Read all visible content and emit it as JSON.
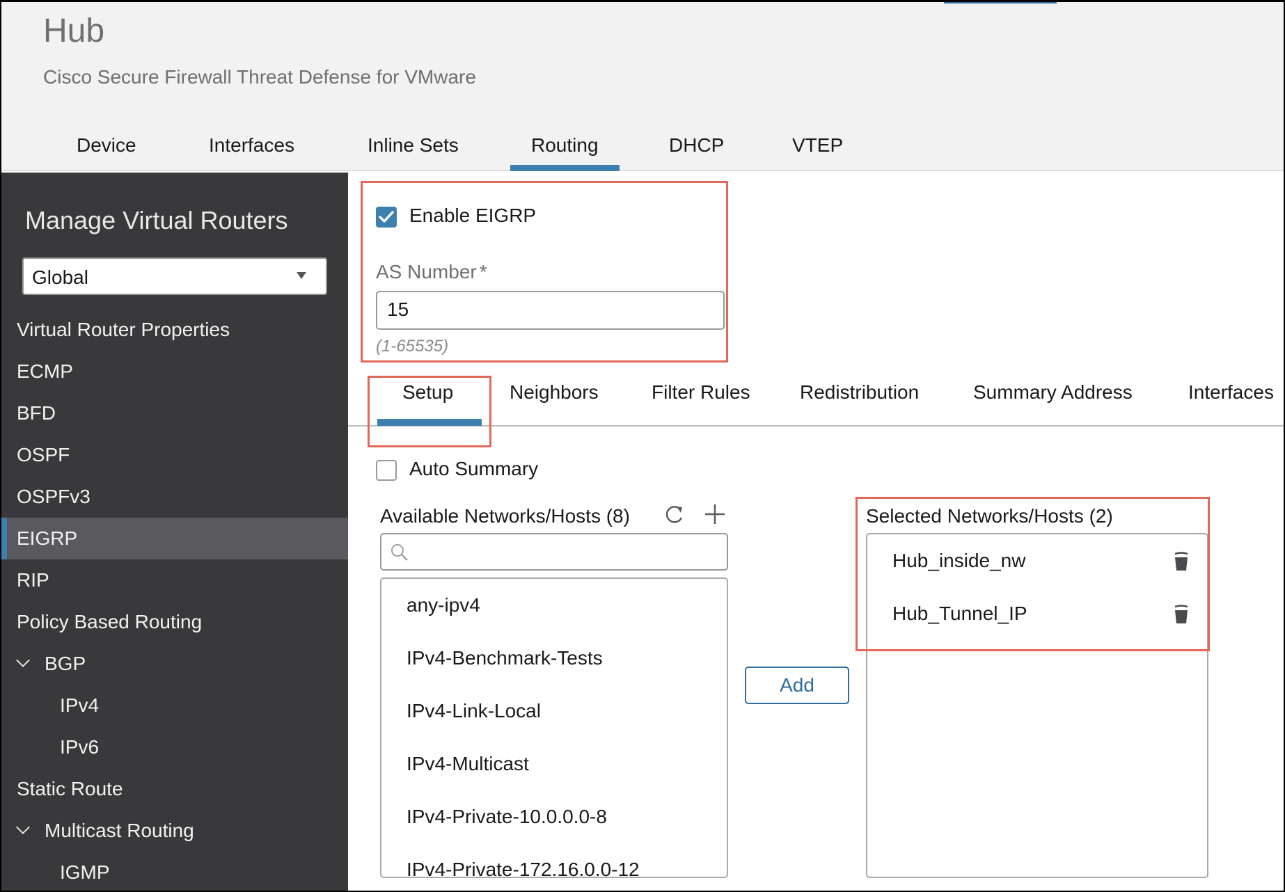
{
  "header": {
    "device_name": "Hub",
    "device_model": "Cisco Secure Firewall Threat Defense for VMware",
    "tabs": [
      {
        "label": "Device",
        "active": false
      },
      {
        "label": "Interfaces",
        "active": false
      },
      {
        "label": "Inline Sets",
        "active": false
      },
      {
        "label": "Routing",
        "active": true
      },
      {
        "label": "DHCP",
        "active": false
      },
      {
        "label": "VTEP",
        "active": false
      }
    ]
  },
  "sidebar": {
    "title": "Manage Virtual Routers",
    "router_select": {
      "value": "Global"
    },
    "items": [
      {
        "label": "Virtual Router Properties",
        "level": 0
      },
      {
        "label": "ECMP",
        "level": 0
      },
      {
        "label": "BFD",
        "level": 0
      },
      {
        "label": "OSPF",
        "level": 0
      },
      {
        "label": "OSPFv3",
        "level": 0
      },
      {
        "label": "EIGRP",
        "level": 0,
        "active": true
      },
      {
        "label": "RIP",
        "level": 0
      },
      {
        "label": "Policy Based Routing",
        "level": 0
      },
      {
        "label": "BGP",
        "level": 0,
        "expanded": true
      },
      {
        "label": "IPv4",
        "level": 1
      },
      {
        "label": "IPv6",
        "level": 1
      },
      {
        "label": "Static Route",
        "level": 0
      },
      {
        "label": "Multicast Routing",
        "level": 0,
        "expanded": true
      },
      {
        "label": "IGMP",
        "level": 1
      }
    ]
  },
  "eigrp": {
    "enable_label": "Enable EIGRP",
    "enabled": true,
    "as_number_label": "AS Number",
    "required_marker": "*",
    "as_number_value": "15",
    "as_number_hint": "(1-65535)"
  },
  "sub_tabs": [
    {
      "label": "Setup",
      "active": true
    },
    {
      "label": "Neighbors",
      "active": false
    },
    {
      "label": "Filter Rules",
      "active": false
    },
    {
      "label": "Redistribution",
      "active": false
    },
    {
      "label": "Summary Address",
      "active": false
    },
    {
      "label": "Interfaces",
      "active": false
    }
  ],
  "setup": {
    "auto_summary_label": "Auto Summary",
    "auto_summary_checked": false,
    "available": {
      "title": "Available Networks/Hosts (8)",
      "search_placeholder": "",
      "items": [
        "any-ipv4",
        "IPv4-Benchmark-Tests",
        "IPv4-Link-Local",
        "IPv4-Multicast",
        "IPv4-Private-10.0.0.0-8",
        "IPv4-Private-172.16.0.0-12"
      ]
    },
    "add_button": "Add",
    "selected": {
      "title": "Selected Networks/Hosts (2)",
      "items": [
        "Hub_inside_nw",
        "Hub_Tunnel_IP"
      ]
    }
  },
  "colors": {
    "accent": "#3b80ae",
    "highlight_box": "#e2685a",
    "sidebar_bg": "#39393b",
    "sidebar_active_bg": "#59595e",
    "header_bg": "#f2f2f2"
  }
}
